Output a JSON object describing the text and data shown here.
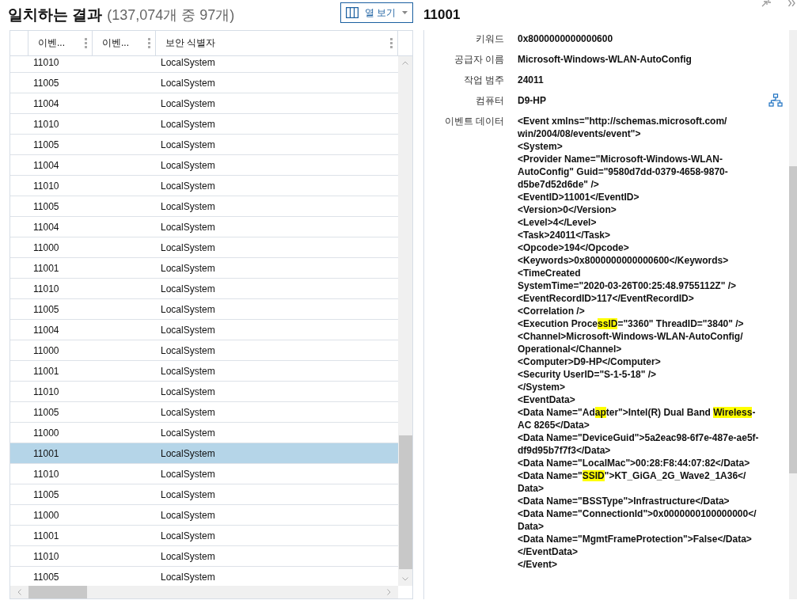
{
  "results_header": {
    "title": "일치하는 결과",
    "count": "(137,074개 중 97개)"
  },
  "column_view_button": {
    "label": "열 보기"
  },
  "table": {
    "columns": [
      "이벤...",
      "이벤...",
      "보안 식별자"
    ],
    "rows": [
      {
        "column_1": "11010",
        "column_3": "LocalSystem",
        "selected": false
      },
      {
        "column_1": "11005",
        "column_3": "LocalSystem",
        "selected": false
      },
      {
        "column_1": "11004",
        "column_3": "LocalSystem",
        "selected": false
      },
      {
        "column_1": "11010",
        "column_3": "LocalSystem",
        "selected": false
      },
      {
        "column_1": "11005",
        "column_3": "LocalSystem",
        "selected": false
      },
      {
        "column_1": "11004",
        "column_3": "LocalSystem",
        "selected": false
      },
      {
        "column_1": "11010",
        "column_3": "LocalSystem",
        "selected": false
      },
      {
        "column_1": "11005",
        "column_3": "LocalSystem",
        "selected": false
      },
      {
        "column_1": "11004",
        "column_3": "LocalSystem",
        "selected": false
      },
      {
        "column_1": "11000",
        "column_3": "LocalSystem",
        "selected": false
      },
      {
        "column_1": "11001",
        "column_3": "LocalSystem",
        "selected": false
      },
      {
        "column_1": "11010",
        "column_3": "LocalSystem",
        "selected": false
      },
      {
        "column_1": "11005",
        "column_3": "LocalSystem",
        "selected": false
      },
      {
        "column_1": "11004",
        "column_3": "LocalSystem",
        "selected": false
      },
      {
        "column_1": "11000",
        "column_3": "LocalSystem",
        "selected": false
      },
      {
        "column_1": "11001",
        "column_3": "LocalSystem",
        "selected": false
      },
      {
        "column_1": "11010",
        "column_3": "LocalSystem",
        "selected": false
      },
      {
        "column_1": "11005",
        "column_3": "LocalSystem",
        "selected": false
      },
      {
        "column_1": "11000",
        "column_3": "LocalSystem",
        "selected": false
      },
      {
        "column_1": "11001",
        "column_3": "LocalSystem",
        "selected": true
      },
      {
        "column_1": "11010",
        "column_3": "LocalSystem",
        "selected": false
      },
      {
        "column_1": "11005",
        "column_3": "LocalSystem",
        "selected": false
      },
      {
        "column_1": "11000",
        "column_3": "LocalSystem",
        "selected": false
      },
      {
        "column_1": "11001",
        "column_3": "LocalSystem",
        "selected": false
      },
      {
        "column_1": "11010",
        "column_3": "LocalSystem",
        "selected": false
      },
      {
        "column_1": "11005",
        "column_3": "LocalSystem",
        "selected": false
      }
    ]
  },
  "detail": {
    "title": "11001",
    "fields": [
      {
        "label": "키워드",
        "value": "0x8000000000000600"
      },
      {
        "label": "공급자 이름",
        "value": "Microsoft-Windows-WLAN-AutoConfig"
      },
      {
        "label": "작업 범주",
        "value": "24011"
      },
      {
        "label": "컴퓨터",
        "value": "D9-HP"
      }
    ],
    "event_data": {
      "label": "이벤트 데이터",
      "lines": [
        "<Event xmlns=\"http://schemas.microsoft.com/",
        "win/2004/08/events/event\">",
        "<System>",
        "<Provider Name=\"Microsoft-Windows-WLAN-",
        "AutoConfig\" Guid=\"9580d7dd-0379-4658-9870-",
        "d5be7d52d6de\" />",
        "<EventID>11001</EventID>",
        "<Version>0</Version>",
        "<Level>4</Level>",
        "<Task>24011</Task>",
        "<Opcode>194</Opcode>",
        "<Keywords>0x8000000000000600</Keywords>",
        "<TimeCreated",
        "SystemTime=\"2020-03-26T00:25:48.9755112Z\" />",
        "<EventRecordID>117</EventRecordID>",
        "<Correlation />",
        {
          "segments": [
            {
              "text": "<Execution Proce",
              "highlight": false
            },
            {
              "text": "ssID",
              "highlight": true
            },
            {
              "text": "=\"3360\" ThreadID=\"3840\" />",
              "highlight": false
            }
          ]
        },
        "<Channel>Microsoft-Windows-WLAN-AutoConfig/",
        "Operational</Channel>",
        "<Computer>D9-HP</Computer>",
        "<Security UserID=\"S-1-5-18\" />",
        "</System>",
        "<EventData>",
        {
          "segments": [
            {
              "text": "<Data Name=\"Ad",
              "highlight": false
            },
            {
              "text": "ap",
              "highlight": true
            },
            {
              "text": "ter\">Intel(R) Dual Band ",
              "highlight": false
            },
            {
              "text": "Wireless",
              "highlight": true
            },
            {
              "text": "-",
              "highlight": false
            }
          ]
        },
        "AC 8265</Data>",
        "<Data Name=\"DeviceGuid\">5a2eac98-6f7e-487e-ae5f-",
        "df9d95b7f7f3</Data>",
        "<Data Name=\"LocalMac\">00:28:F8:44:07:82</Data>",
        {
          "segments": [
            {
              "text": "<Data Name=\"",
              "highlight": false
            },
            {
              "text": "SSID",
              "highlight": true
            },
            {
              "text": "\">KT_GiGA_2G_Wave2_1A36</",
              "highlight": false
            }
          ]
        },
        "Data>",
        "<Data Name=\"BSSType\">Infrastructure</Data>",
        "<Data Name=\"ConnectionId\">0x0000000100000000</",
        "Data>",
        "<Data Name=\"MgmtFrameProtection\">False</Data>",
        "</EventData>",
        "</Event>"
      ]
    }
  }
}
